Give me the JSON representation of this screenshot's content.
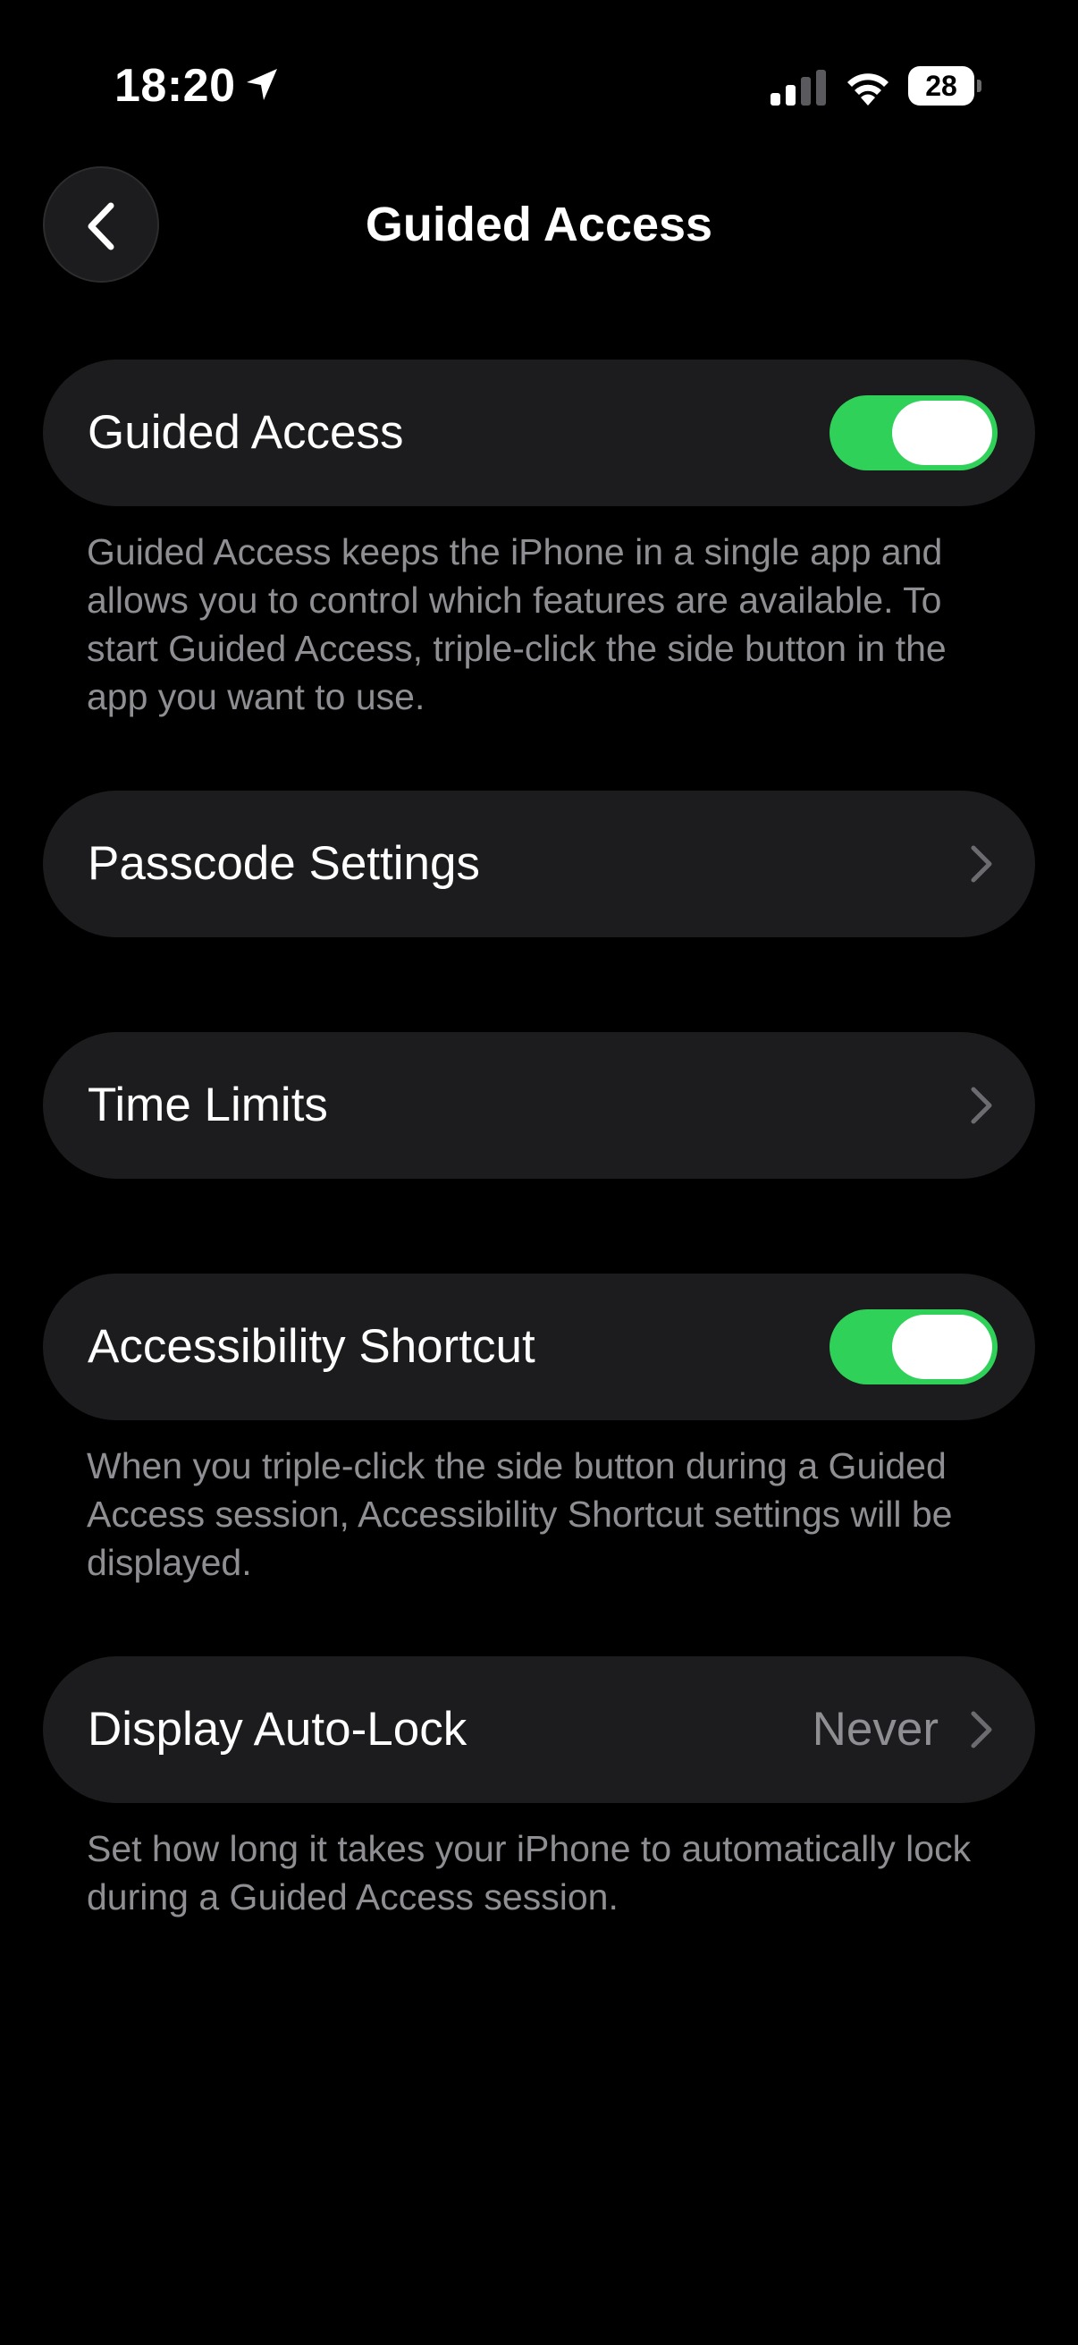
{
  "status_bar": {
    "time": "18:20",
    "battery": "28"
  },
  "nav": {
    "title": "Guided Access"
  },
  "rows": {
    "guided_access": {
      "label": "Guided Access",
      "enabled": true,
      "footer": "Guided Access keeps the iPhone in a single app and allows you to control which features are available. To start Guided Access, triple-click the side button in the app you want to use."
    },
    "passcode_settings": {
      "label": "Passcode Settings"
    },
    "time_limits": {
      "label": "Time Limits"
    },
    "accessibility_shortcut": {
      "label": "Accessibility Shortcut",
      "enabled": true,
      "footer": "When you triple-click the side button during a Guided Access session, Accessibility Shortcut settings will be displayed."
    },
    "display_auto_lock": {
      "label": "Display Auto-Lock",
      "value": "Never",
      "footer": "Set how long it takes your iPhone to automatically lock during a Guided Access session."
    }
  },
  "colors": {
    "toggle_on": "#30d158",
    "cell_background": "#1c1c1e",
    "secondary_text": "#8e8e93"
  },
  "icons": {
    "back": "chevron-left-icon",
    "disclosure": "chevron-right-icon",
    "location": "location-arrow-icon",
    "signal": "cellular-signal-icon",
    "wifi": "wifi-icon",
    "battery": "battery-icon"
  }
}
